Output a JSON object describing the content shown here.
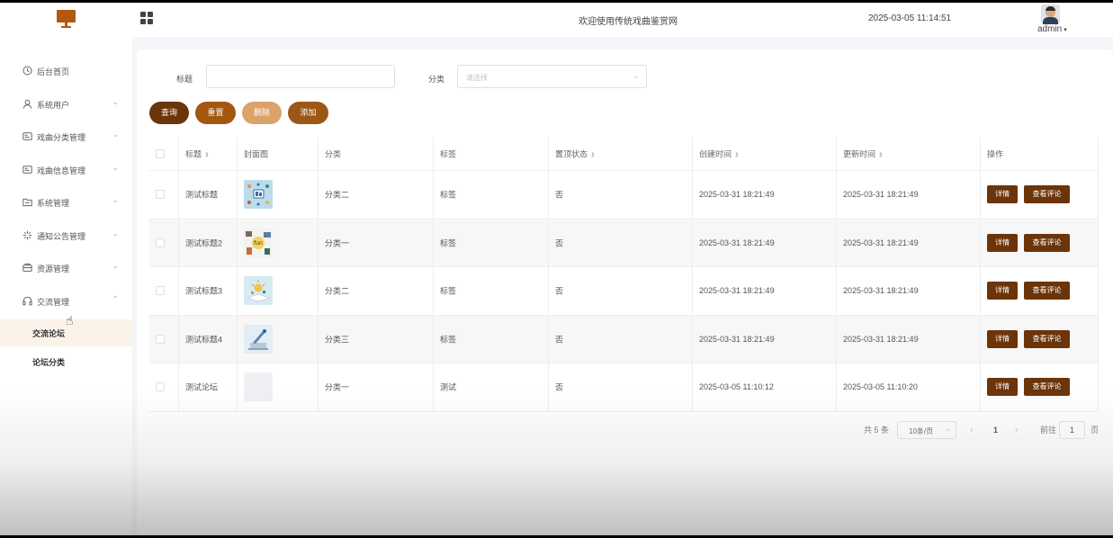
{
  "header": {
    "title": "欢迎使用传统戏曲鉴赏网",
    "datetime": "2025-03-05 11:14:51",
    "user": "admin",
    "user_caret": "▾",
    "brand_color": "#b3590f"
  },
  "sidebar": {
    "items": [
      {
        "label": "后台首页",
        "icon": "clock-icon",
        "chevron": ""
      },
      {
        "label": "系统用户",
        "icon": "user-icon",
        "chevron": "⌄"
      },
      {
        "label": "戏曲分类管理",
        "icon": "card-icon",
        "chevron": "⌄"
      },
      {
        "label": "戏曲信息管理",
        "icon": "card-icon",
        "chevron": "⌄"
      },
      {
        "label": "系统管理",
        "icon": "folder-icon",
        "chevron": "⌄"
      },
      {
        "label": "通知公告管理",
        "icon": "sparkle-icon",
        "chevron": "⌄"
      },
      {
        "label": "资源管理",
        "icon": "box-icon",
        "chevron": "⌄"
      },
      {
        "label": "交流管理",
        "icon": "headset-icon",
        "chevron": "⌃"
      }
    ],
    "subitems": [
      {
        "label": "交流论坛",
        "active": true
      },
      {
        "label": "论坛分类",
        "active": false
      }
    ],
    "active_bg": "#fbf3ea"
  },
  "filters": {
    "title_label": "标题",
    "title_value": "",
    "category_label": "分类",
    "category_placeholder": "请选择",
    "select_arrow": "⌄"
  },
  "actions": {
    "query": "查询",
    "reset": "重置",
    "delete": "删除",
    "add": "添加",
    "colors": {
      "query": "#6b3409",
      "reset": "#a3570f",
      "delete": "#dba269",
      "add": "#9b5716"
    }
  },
  "table": {
    "sort_glyph": "⇕",
    "columns": [
      "标题",
      "封面图",
      "分类",
      "标签",
      "置顶状态",
      "创建时间",
      "更新时间",
      "操作"
    ],
    "rows": [
      {
        "title": "测试标题",
        "category": "分类二",
        "tag": "标签",
        "pinned": "否",
        "created": "2025-03-31 18:21:49",
        "updated": "2025-03-31 18:21:49",
        "cover": "cover-1"
      },
      {
        "title": "测试标题2",
        "category": "分类一",
        "tag": "标签",
        "pinned": "否",
        "created": "2025-03-31 18:21:49",
        "updated": "2025-03-31 18:21:49",
        "cover": "cover-2"
      },
      {
        "title": "测试标题3",
        "category": "分类二",
        "tag": "标签",
        "pinned": "否",
        "created": "2025-03-31 18:21:49",
        "updated": "2025-03-31 18:21:49",
        "cover": "cover-3"
      },
      {
        "title": "测试标题4",
        "category": "分类三",
        "tag": "标签",
        "pinned": "否",
        "created": "2025-03-31 18:21:49",
        "updated": "2025-03-31 18:21:49",
        "cover": "cover-4"
      },
      {
        "title": "测试论坛",
        "category": "分类一",
        "tag": "测试",
        "pinned": "否",
        "created": "2025-03-05 11:10:12",
        "updated": "2025-03-05 11:10:20",
        "cover": ""
      }
    ],
    "row_actions": {
      "detail": "详情",
      "comments": "查看评论"
    }
  },
  "pagination": {
    "total": "共 5 条",
    "page_size": "10条/页",
    "prev": "‹",
    "current": "1",
    "next": "›",
    "goto_label": "前往",
    "goto_value": "1",
    "page_suffix": "页",
    "active_color": "#6b3409"
  }
}
